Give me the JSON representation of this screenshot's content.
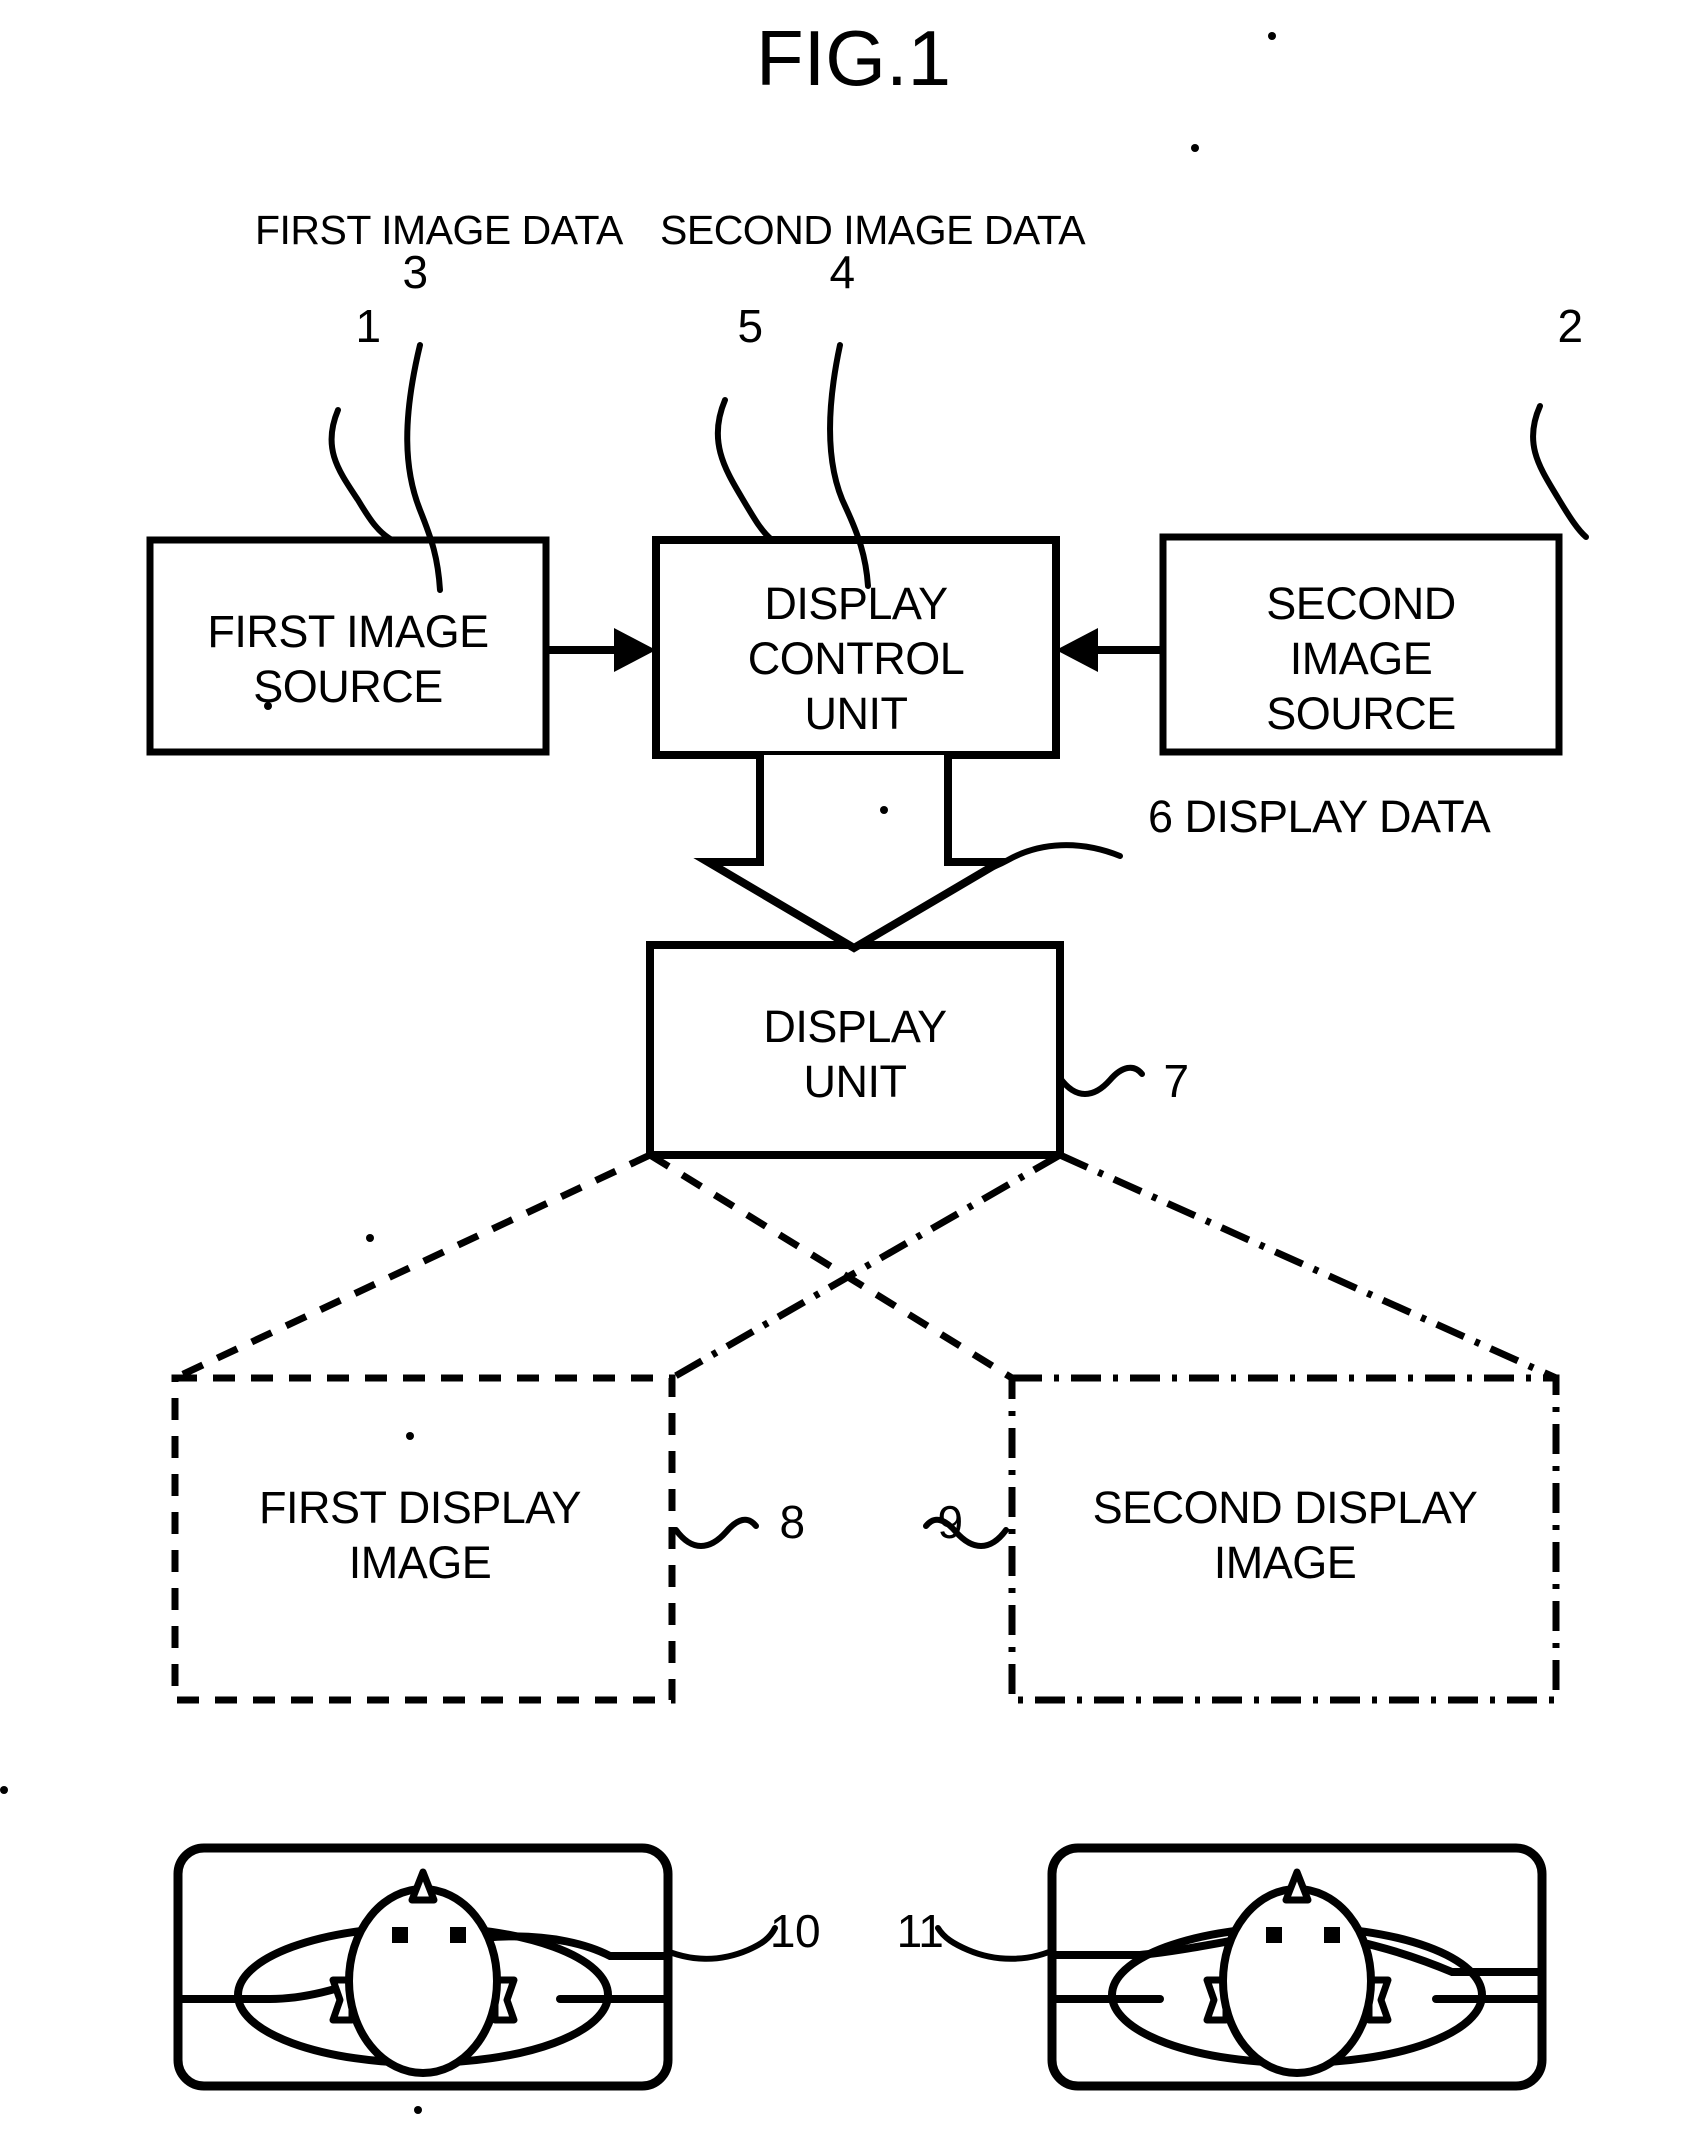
{
  "figure": {
    "title": "FIG.1",
    "type": "patent-block-diagram"
  },
  "headers": {
    "first_image_data": "FIRST IMAGE DATA",
    "second_image_data": "SECOND IMAGE DATA"
  },
  "blocks": {
    "first_image_source": "FIRST IMAGE\nSOURCE",
    "display_control_unit": "DISPLAY\nCONTROL\nUNIT",
    "second_image_source": "SECOND\nIMAGE\nSOURCE",
    "display_unit": "DISPLAY\nUNIT",
    "first_display_image": "FIRST DISPLAY\nIMAGE",
    "second_display_image": "SECOND DISPLAY\nIMAGE"
  },
  "flow": {
    "display_data_label": "6 DISPLAY DATA"
  },
  "reference_numerals": {
    "first_image_source": "1",
    "second_image_source": "2",
    "first_image_data": "3",
    "second_image_data": "4",
    "display_control_unit": "5",
    "display_data": "6",
    "display_unit": "7",
    "first_display_image": "8",
    "second_display_image": "9",
    "left_rendered_image": "10",
    "right_rendered_image": "11"
  },
  "colors": {
    "ink": "#000000",
    "paper": "#ffffff"
  }
}
